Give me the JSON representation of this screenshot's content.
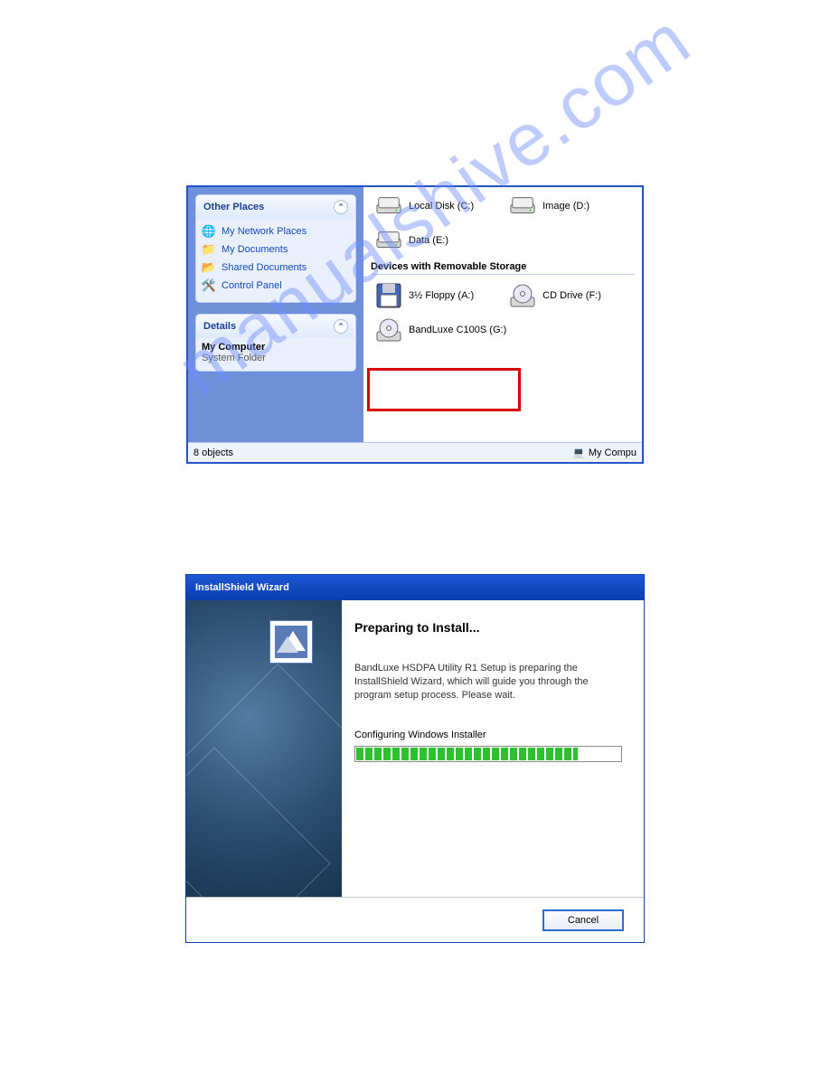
{
  "watermark": "manualshive.com",
  "explorer": {
    "sidebar": {
      "other_places_header": "Other Places",
      "links": [
        {
          "label": "My Network Places",
          "icon": "🌐"
        },
        {
          "label": "My Documents",
          "icon": "📁"
        },
        {
          "label": "Shared Documents",
          "icon": "📂"
        },
        {
          "label": "Control Panel",
          "icon": "🛠️"
        }
      ],
      "details_header": "Details",
      "details_name": "My Computer",
      "details_type": "System Folder"
    },
    "content": {
      "drives": [
        {
          "label": "Local Disk (C:)"
        },
        {
          "label": "Image (D:)"
        },
        {
          "label": "Data (E:)"
        }
      ],
      "removable_header": "Devices with Removable Storage",
      "removable": [
        {
          "label": "3½ Floppy (A:)"
        },
        {
          "label": "CD Drive (F:)"
        },
        {
          "label": "BandLuxe C100S (G:)"
        }
      ]
    },
    "status": {
      "left": "8 objects",
      "right": "My Compu"
    }
  },
  "wizard": {
    "title": "InstallShield Wizard",
    "heading": "Preparing to Install...",
    "description": "BandLuxe HSDPA Utility R1 Setup is preparing the InstallShield Wizard, which will guide you through the program setup process.  Please wait.",
    "status_text": "Configuring Windows Installer",
    "cancel": "Cancel",
    "progress_pct": 84
  }
}
